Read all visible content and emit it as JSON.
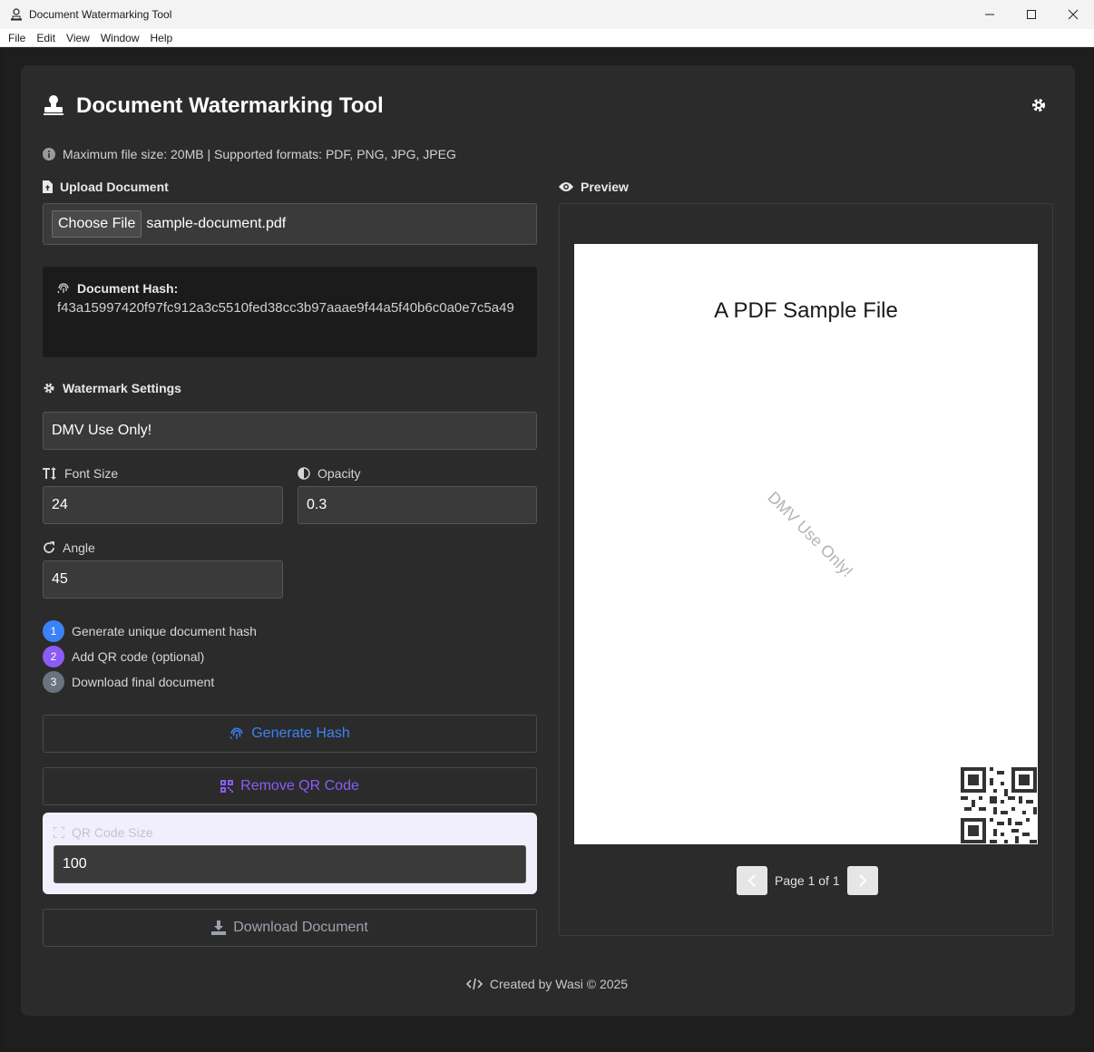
{
  "window": {
    "title": "Document Watermarking Tool",
    "menu": [
      "File",
      "Edit",
      "View",
      "Window",
      "Help"
    ]
  },
  "header": {
    "title": "Document Watermarking Tool",
    "info": "Maximum file size: 20MB | Supported formats: PDF, PNG, JPG, JPEG"
  },
  "upload": {
    "label": "Upload Document",
    "button": "Choose File",
    "file_name": "sample-document.pdf"
  },
  "hash": {
    "label": "Document Hash:",
    "value": "f43a15997420f97fc912a3c5510fed38cc3b97aaae9f44a5f40b6c0a0e7c5a49"
  },
  "settings": {
    "label": "Watermark Settings",
    "text": "DMV Use Only!",
    "font_size_label": "Font Size",
    "font_size": "24",
    "opacity_label": "Opacity",
    "opacity": "0.3",
    "angle_label": "Angle",
    "angle": "45"
  },
  "steps": [
    {
      "num": "1",
      "label": "Generate unique document hash",
      "color": "#3b82f6"
    },
    {
      "num": "2",
      "label": "Add QR code (optional)",
      "color": "#8b5cf6"
    },
    {
      "num": "3",
      "label": "Download final document",
      "color": "#6b7280"
    }
  ],
  "actions": {
    "generate_hash": "Generate Hash",
    "remove_qr": "Remove QR Code",
    "qr_size_label": "QR Code Size",
    "qr_size": "100",
    "download": "Download Document"
  },
  "preview": {
    "label": "Preview",
    "pdf_title": "A PDF Sample File",
    "watermark": "DMV Use Only!",
    "page_text": "Page 1 of 1"
  },
  "footer": {
    "text": "Created by Wasi © 2025"
  },
  "colors": {
    "blue": "#3b82f6",
    "purple": "#8b5cf6",
    "gray": "#9ca3af"
  }
}
